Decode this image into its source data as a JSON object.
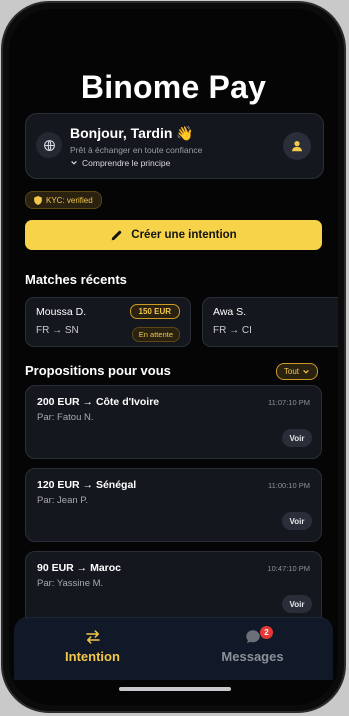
{
  "app": {
    "title": "Binome Pay"
  },
  "greeting": {
    "title": "Bonjour, Tardin 👋",
    "subtitle": "Prêt à échanger en toute confiance",
    "link": "Comprendre le principe"
  },
  "kyc": {
    "label": "KYC: verified"
  },
  "create_button": {
    "label": "Créer une intention"
  },
  "matches": {
    "title": "Matches récents",
    "items": [
      {
        "name": "Moussa D.",
        "route": "FR → SN",
        "amount": "150 EUR",
        "status": "En attente"
      },
      {
        "name": "Awa S.",
        "route": "FR → CI"
      }
    ]
  },
  "proposals": {
    "title": "Propositions pour vous",
    "filter": "Tout",
    "items": [
      {
        "title": "200 EUR → Côte d'Ivoire",
        "from": "Par: Fatou N.",
        "time": "11:07:10 PM",
        "action": "Voir"
      },
      {
        "title": "120 EUR → Sénégal",
        "from": "Par: Jean P.",
        "time": "11:00:10 PM",
        "action": "Voir"
      },
      {
        "title": "90 EUR → Maroc",
        "from": "Par: Yassine M.",
        "time": "10:47:10 PM",
        "action": "Voir"
      }
    ]
  },
  "tabbar": {
    "tabs": [
      {
        "label": "Intention",
        "icon": "swap-arrows-icon",
        "active": true
      },
      {
        "label": "Messages",
        "icon": "chat-bubble-icon",
        "badge": "2"
      }
    ]
  },
  "colors": {
    "accent": "#f7d34a",
    "card": "#14171d",
    "background": "#050506"
  }
}
